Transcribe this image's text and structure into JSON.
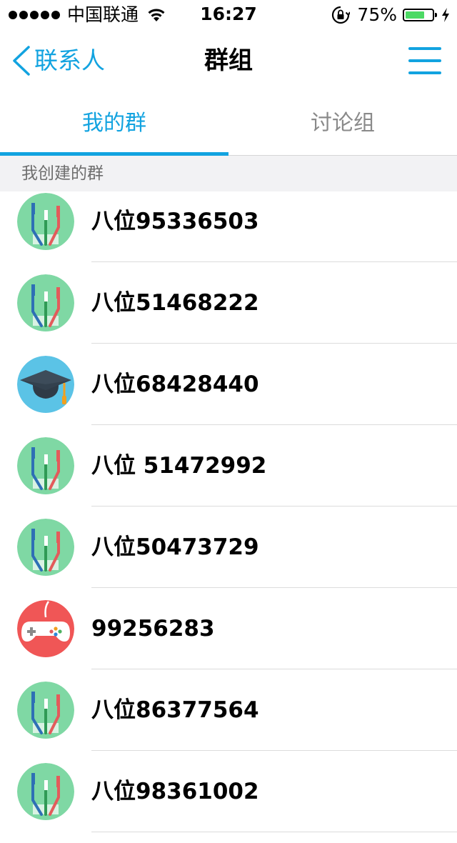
{
  "status_bar": {
    "carrier": "中国联通",
    "time": "16:27",
    "battery_percent": "75%",
    "battery_level": 0.75,
    "battery_color": "#4cd964"
  },
  "nav": {
    "back_label": "联系人",
    "title": "群组",
    "menu_icon": "hamburger-menu-icon",
    "accent_color": "#12a3e0"
  },
  "tabs": [
    {
      "label": "我的群",
      "active": true
    },
    {
      "label": "讨论组",
      "active": false
    }
  ],
  "section": {
    "title": "我创建的群"
  },
  "groups": [
    {
      "name": "八位95336503",
      "avatar": "toothbrush-avatar-icon"
    },
    {
      "name": "八位51468222",
      "avatar": "toothbrush-avatar-icon"
    },
    {
      "name": "八位68428440",
      "avatar": "graduation-cap-avatar-icon"
    },
    {
      "name": "八位 51472992",
      "avatar": "toothbrush-avatar-icon"
    },
    {
      "name": "八位50473729",
      "avatar": "toothbrush-avatar-icon"
    },
    {
      "name": "99256283",
      "avatar": "gamepad-avatar-icon"
    },
    {
      "name": "八位86377564",
      "avatar": "toothbrush-avatar-icon"
    },
    {
      "name": "八位98361002",
      "avatar": "toothbrush-avatar-icon"
    }
  ]
}
